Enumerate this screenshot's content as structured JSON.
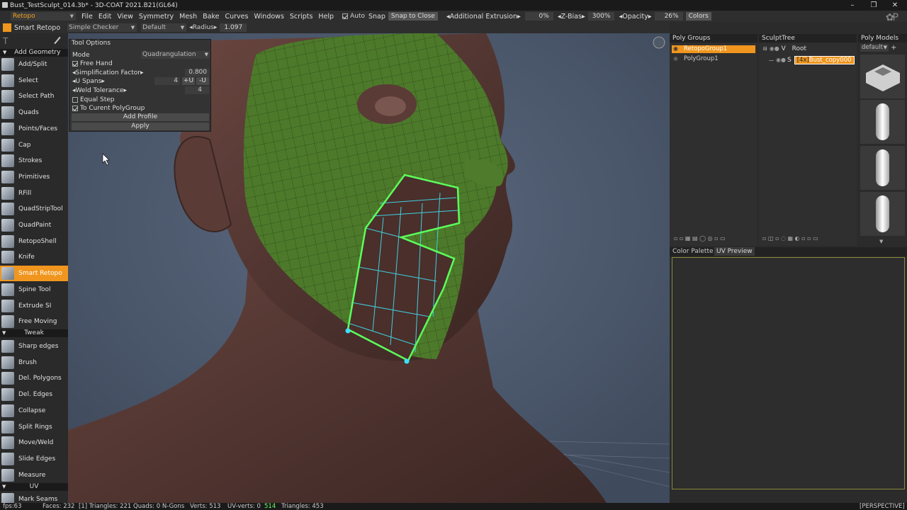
{
  "window": {
    "file_title": "Bust_TestSculpt_014.3b* - 3D-COAT 2021.B21(GL64)",
    "controls": [
      "–",
      "❐",
      "✕"
    ]
  },
  "menubar": {
    "room": "Retopo",
    "menus": [
      "File",
      "Edit",
      "View",
      "Symmetry",
      "Mesh",
      "Bake",
      "Curves",
      "Windows",
      "Scripts",
      "Help"
    ],
    "auto_snap_label": "Auto",
    "snap_label": "Snap",
    "snap_to_close": "Snap to Close",
    "additional_extrusion_label": "Additional Extrusion",
    "additional_extrusion_value": "0%",
    "zbias_label": "Z-Bias",
    "zbias_value": "300%",
    "opacity_label": "Opacity",
    "opacity_value": "26%",
    "colors_label": "Colors"
  },
  "toolbar2": {
    "tool_name": "Smart Retopo",
    "shader": "Simple Checker",
    "preset": "Default",
    "radius_label": "Radius",
    "radius_value": "1.097"
  },
  "leftpanel": {
    "section_add": "Add Geometry",
    "section_tweak": "Tweak",
    "section_uv": "UV",
    "add_tools": [
      "Add/Split",
      "Select",
      "Select Path",
      "Quads",
      "Points/Faces",
      "Cap",
      "Strokes",
      "Primitives",
      "RFill",
      "QuadStripTool",
      "QuadPaint",
      "RetopoShell",
      "Knife",
      "Smart Retopo",
      "Spine Tool",
      "Extrude SI",
      "Free Moving"
    ],
    "tweak_tools": [
      "Sharp edges",
      "Brush",
      "Del. Polygons",
      "Del. Edges",
      "Collapse",
      "Split Rings",
      "Move/Weld",
      "Slide Edges",
      "Measure"
    ],
    "uv_tools": [
      "Mark Seams"
    ],
    "active_tool": "Smart Retopo"
  },
  "tool_options": {
    "title": "Tool Options",
    "mode_label": "Mode",
    "mode_value": "Quadrangulation",
    "free_hand": "Free Hand",
    "simplification_label": "Simplification Factor",
    "simplification_value": "0.800",
    "u_spans_label": "U Spans",
    "u_spans_value": "4",
    "u_plus": "+U",
    "u_minus": "-U",
    "weld_label": "Weld Tolerance",
    "weld_value": "4",
    "equal_step": "Equal Step",
    "to_current": "To Curent PolyGroup",
    "add_profile": "Add Profile",
    "apply": "Apply"
  },
  "polygroups": {
    "title": "Poly Groups",
    "items": [
      "RetopoGroup1",
      "PolyGroup1"
    ]
  },
  "sculpttree": {
    "title": "SculptTree",
    "root": "Root",
    "root_flags": "V",
    "child_flags": "S",
    "child_badge": "[4x]",
    "child_name": "Bust_copy000"
  },
  "polymodels": {
    "title": "Poly Models",
    "filter": "default"
  },
  "bottom_tabs": [
    "Color Palette",
    "UV Preview"
  ],
  "viewport": {
    "projection": "PERSPECTIVE"
  },
  "statusbar": {
    "fps": "fps:63",
    "faces": "Faces: 232",
    "sub": "[1] Triangles: 221 Quads: 0 N-Gons",
    "verts": "Verts: 513",
    "uv_verts_label": "UV-verts: 0",
    "uv_highlight": "514",
    "triangles": "Triangles: 453",
    "right": "[PERSPECTIVE]"
  }
}
